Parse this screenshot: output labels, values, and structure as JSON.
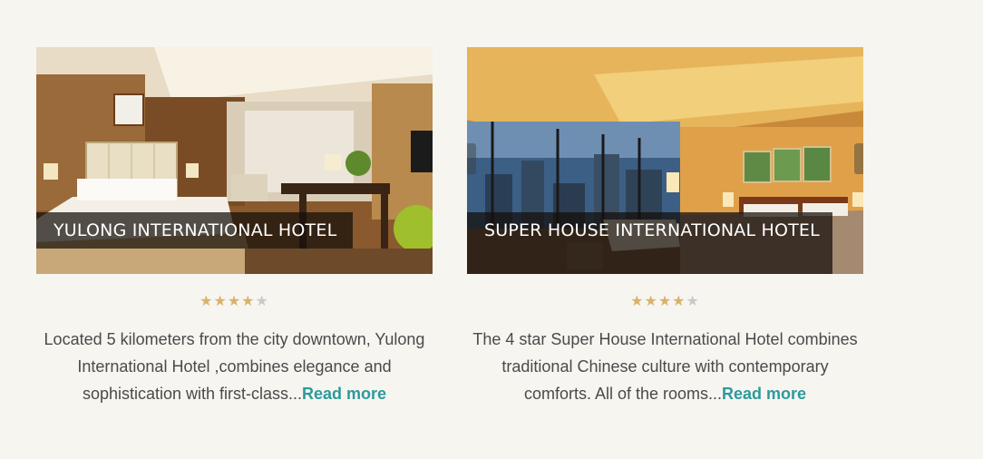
{
  "colors": {
    "background": "#f6f5f0",
    "accent_link": "#2c9a9c",
    "star_on": "#d9b26a",
    "star_off": "#c9c9c9",
    "text": "#4a4a4a"
  },
  "hotels": [
    {
      "name": "YULONG INTERNATIONAL HOTEL",
      "rating": 4,
      "rating_max": 5,
      "description": "Located 5 kilometers from the city downtown, Yulong International Hotel ,combines elegance and sophistication with first-class...",
      "read_more": "Read more",
      "image_icon": "hotel-room-photo"
    },
    {
      "name": "SUPER HOUSE INTERNATIONAL HOTEL",
      "rating": 4,
      "rating_max": 5,
      "description": "The 4 star Super House International Hotel combines traditional Chinese culture with contemporary comforts. All of the rooms...",
      "read_more": "Read more",
      "image_icon": "hotel-room-photo"
    }
  ],
  "star_glyph": "★"
}
